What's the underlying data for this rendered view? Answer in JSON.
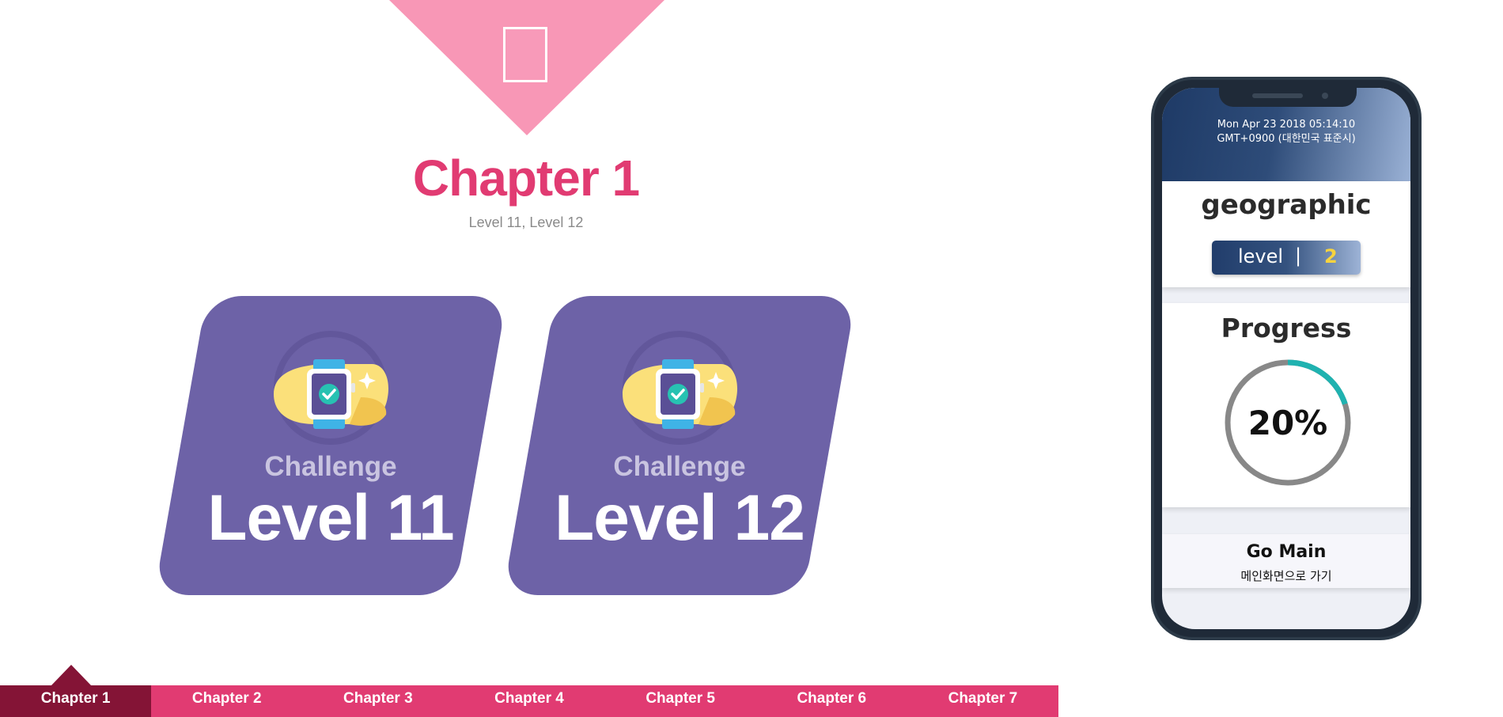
{
  "header": {
    "title": "Chapter 1",
    "subtitle": "Level 11, Level 12"
  },
  "cards": [
    {
      "kicker": "Challenge",
      "level": "Level 11",
      "icon": "smartwatch-check-icon"
    },
    {
      "kicker": "Challenge",
      "level": "Level 12",
      "icon": "smartwatch-check-icon"
    }
  ],
  "chapter_tabs": {
    "active_index": 0,
    "items": [
      "Chapter 1",
      "Chapter 2",
      "Chapter 3",
      "Chapter 4",
      "Chapter 5",
      "Chapter 6",
      "Chapter 7"
    ]
  },
  "phone": {
    "datetime_line1": "Mon Apr 23 2018 05:14:10",
    "datetime_line2": "GMT+0900 (대한민국 표준시)",
    "topic": "geographic",
    "level_label": "level",
    "level_separator": "|",
    "level_value": "2",
    "progress_title": "Progress",
    "progress_percent": 20,
    "progress_text": "20%",
    "go_main_label": "Go Main",
    "go_main_sub": "메인화면으로 가기"
  },
  "colors": {
    "accent_pink": "#e13b72",
    "tab_active": "#841436",
    "card_purple": "#6d62a7",
    "progress_teal": "#1fb2b0",
    "progress_track": "#888888",
    "level_number": "#f7d33e"
  }
}
